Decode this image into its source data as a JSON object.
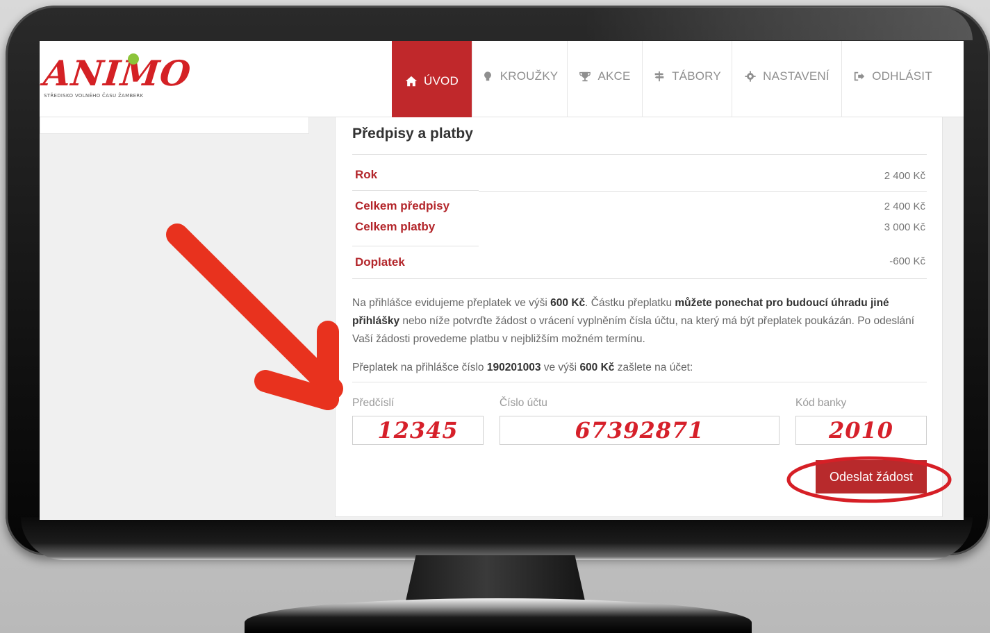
{
  "brand": {
    "logo_text": "ANIMO",
    "logo_subtitle": "STŘEDISKO VOLNÉHO ČASU ŽAMBERK"
  },
  "nav": [
    {
      "label": "ÚVOD",
      "icon": "home-icon",
      "active": true
    },
    {
      "label": "KROUŽKY",
      "icon": "lightbulb-icon",
      "active": false
    },
    {
      "label": "AKCE",
      "icon": "trophy-icon",
      "active": false
    },
    {
      "label": "TÁBORY",
      "icon": "signpost-icon",
      "active": false
    },
    {
      "label": "NASTAVENÍ",
      "icon": "gear-icon",
      "active": false
    },
    {
      "label": "ODHLÁSIT",
      "icon": "sign-out-icon",
      "active": false
    }
  ],
  "panel": {
    "title": "Předpisy a platby",
    "rows": [
      {
        "label": "Rok",
        "value": "2 400 Kč"
      },
      {
        "label": "Celkem předpisy",
        "value": "2 400 Kč"
      },
      {
        "label": "Celkem platby",
        "value": "3 000 Kč"
      },
      {
        "label": "Doplatek",
        "value": "-600 Kč"
      }
    ],
    "info": {
      "p1": "Na přihlášce evidujeme přeplatek ve výši ",
      "amount1": "600 Kč",
      "p2": ". Částku přeplatku ",
      "bold2": "můžete ponechat pro budoucí úhradu jiné přihlášky",
      "p3": " nebo níže potvrďte žádost o vrácení vyplněním čísla účtu, na který má být přeplatek poukázán. Po odeslání Vaší žádosti provedeme platbu v nejbližším možném termínu."
    },
    "refund": {
      "p1": "Přeplatek na přihlášce číslo ",
      "application_number": "190201003",
      "p2": " ve výši ",
      "amount": "600 Kč",
      "p3": " zašlete na účet:"
    },
    "fields": {
      "prefix_label": "Předčíslí",
      "prefix_value": "12345",
      "account_label": "Číslo účtu",
      "account_value": "67392871",
      "bank_label": "Kód banky",
      "bank_value": "2010"
    },
    "submit_label": "Odeslat žádost"
  },
  "annotation_colors": {
    "arrow": "#e8321e",
    "circle": "#d61f26"
  }
}
